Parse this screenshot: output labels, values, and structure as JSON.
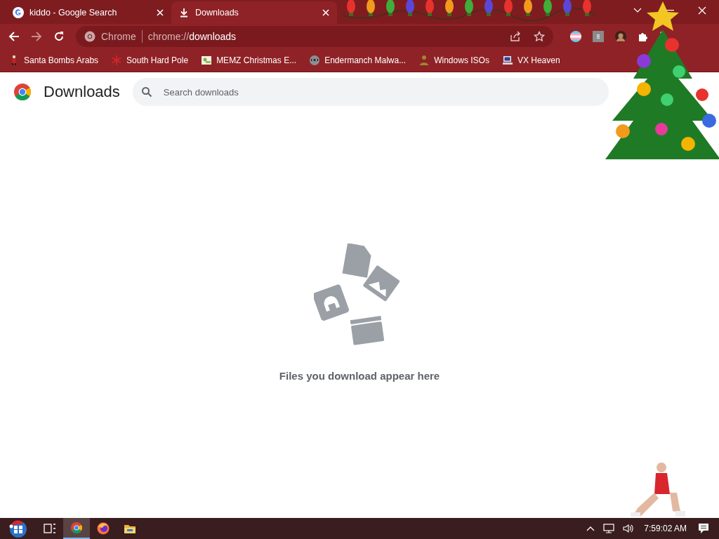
{
  "tabs": [
    {
      "title": "kiddo - Google Search",
      "selected": false
    },
    {
      "title": "Downloads",
      "selected": true
    }
  ],
  "address_bar": {
    "chip": "Chrome",
    "url_scheme": "chrome://",
    "url_path": "downloads"
  },
  "bookmarks": [
    {
      "title": "Santa Bombs Arabs"
    },
    {
      "title": "South Hard Pole"
    },
    {
      "title": "MEMZ Christmas E..."
    },
    {
      "title": "Endermanch Malwa..."
    },
    {
      "title": "Windows ISOs"
    },
    {
      "title": "VX Heaven"
    }
  ],
  "page": {
    "title": "Downloads",
    "search": {
      "placeholder": "Search downloads"
    },
    "empty_message": "Files you download appear here"
  },
  "taskbar": {
    "apps": [
      {
        "kind": "start",
        "selected": false
      },
      {
        "kind": "taskview",
        "selected": false
      },
      {
        "kind": "chrome",
        "selected": true
      },
      {
        "kind": "firefox",
        "selected": false
      },
      {
        "kind": "explorer",
        "selected": false
      }
    ],
    "time": "7:59:02 AM"
  }
}
